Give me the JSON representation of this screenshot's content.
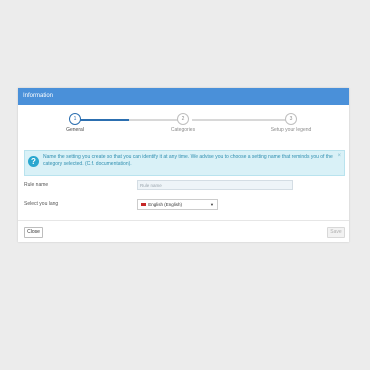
{
  "dialog": {
    "title": "Information",
    "steps": [
      {
        "number": "1",
        "label": "General",
        "active": true
      },
      {
        "number": "2",
        "label": "Categories",
        "active": false
      },
      {
        "number": "3",
        "label": "Setup your legend",
        "active": false
      }
    ],
    "alert": {
      "icon": "info-icon",
      "text": "Name the setting you create so that you can identify it at any time. We advise you to choose a setting name that reminds you of the category selected. (C.f. documentation).",
      "close_glyph": "×"
    },
    "form": {
      "rule_name": {
        "label": "Rule name",
        "placeholder": "Rule name"
      },
      "language": {
        "label": "Select you lang",
        "value": "English (English)"
      }
    },
    "buttons": {
      "close": "Close",
      "save": "Save"
    },
    "colors": {
      "header": "#4a90d9",
      "accent": "#2c6fb0",
      "alert_bg": "#d9f1f7"
    }
  }
}
